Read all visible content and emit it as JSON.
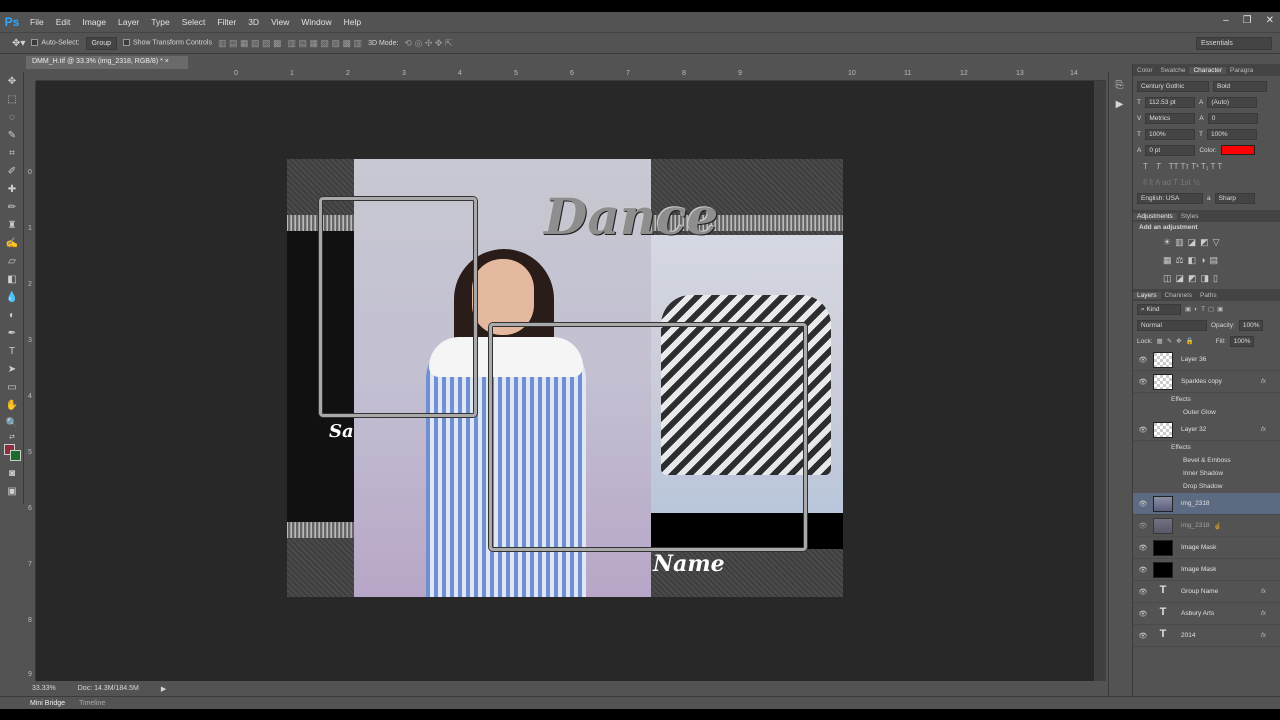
{
  "menu": {
    "logo": "Ps",
    "items": [
      "File",
      "Edit",
      "Image",
      "Layer",
      "Type",
      "Select",
      "Filter",
      "3D",
      "View",
      "Window",
      "Help"
    ]
  },
  "options": {
    "auto_select": "Auto-Select:",
    "auto_select_value": "Group",
    "show_transform": "Show Transform Controls",
    "mode_3d": "3D Mode:",
    "workspace": "Essentials"
  },
  "document": {
    "tab": "DMM_H.tif @ 33.3% (img_2318, RGB/8) *",
    "zoom": "33.33%",
    "doc_size": "Doc: 14.3M/184.5M"
  },
  "ruler": {
    "top": [
      "0",
      "1",
      "2",
      "3",
      "4",
      "5",
      "6",
      "7",
      "8",
      "9",
      "10",
      "11",
      "12",
      "13",
      "14"
    ],
    "left": [
      "0",
      "1",
      "2",
      "3",
      "4",
      "5",
      "6",
      "7",
      "8",
      "9"
    ]
  },
  "artwork": {
    "title": "Dance",
    "name": "Name",
    "partial": "Sa"
  },
  "bottom": {
    "tabs": [
      "Mini Bridge",
      "Timeline"
    ]
  },
  "character": {
    "tabs": [
      "Color",
      "Swatche",
      "Character",
      "Paragra"
    ],
    "font": "Century Gothic",
    "style": "Bold",
    "size": "112.53 pt",
    "leading": "(Auto)",
    "kerning": "Metrics",
    "tracking": "0",
    "vscale": "100%",
    "hscale": "100%",
    "baseline": "0 pt",
    "color_label": "Color:",
    "color": "#ff0000",
    "language": "English: USA",
    "aa": "Sharp"
  },
  "adjustments": {
    "tabs": [
      "Adjustments",
      "Styles"
    ],
    "heading": "Add an adjustment"
  },
  "layers_panel": {
    "tabs": [
      "Layers",
      "Channels",
      "Paths"
    ],
    "kind": "Kind",
    "blend": "Normal",
    "opacity_label": "Opacity:",
    "opacity": "100%",
    "lock_label": "Lock:",
    "fill_label": "Fill:",
    "fill": "100%",
    "layers": [
      {
        "name": "Layer 36",
        "thumb": "checker",
        "fx": ""
      },
      {
        "name": "Sparkles copy",
        "thumb": "checker",
        "fx": "fx"
      },
      {
        "name": "Layer 32",
        "thumb": "checker",
        "fx": "fx"
      },
      {
        "name": "img_2318",
        "thumb": "photo",
        "fx": ""
      },
      {
        "name": "img_2318",
        "thumb": "photo",
        "fx": ""
      },
      {
        "name": "Image Mask",
        "thumb": "black",
        "fx": ""
      },
      {
        "name": "Image Mask",
        "thumb": "black",
        "fx": ""
      },
      {
        "name": "Group Name",
        "thumb": "type",
        "fx": "fx"
      },
      {
        "name": "Asbury Arts",
        "thumb": "type",
        "fx": "fx"
      },
      {
        "name": "2014",
        "thumb": "type",
        "fx": "fx"
      }
    ],
    "effects_a": {
      "label": "Effects",
      "items": [
        "Outer Glow"
      ]
    },
    "effects_b": {
      "label": "Effects",
      "items": [
        "Bevel & Emboss",
        "Inner Shadow",
        "Drop Shadow"
      ]
    }
  }
}
